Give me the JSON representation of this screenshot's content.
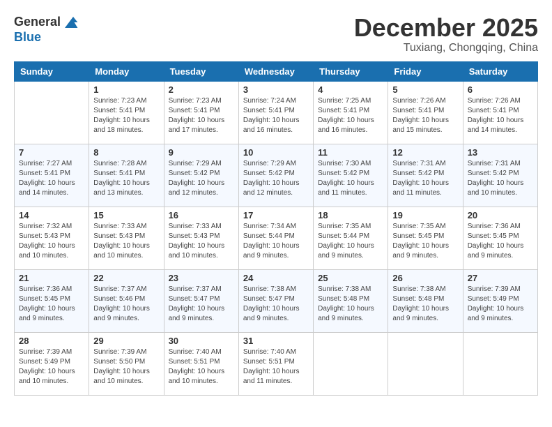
{
  "header": {
    "logo_general": "General",
    "logo_blue": "Blue",
    "month_title": "December 2025",
    "location": "Tuxiang, Chongqing, China"
  },
  "weekdays": [
    "Sunday",
    "Monday",
    "Tuesday",
    "Wednesday",
    "Thursday",
    "Friday",
    "Saturday"
  ],
  "weeks": [
    [
      {
        "day": "",
        "info": ""
      },
      {
        "day": "1",
        "info": "Sunrise: 7:23 AM\nSunset: 5:41 PM\nDaylight: 10 hours\nand 18 minutes."
      },
      {
        "day": "2",
        "info": "Sunrise: 7:23 AM\nSunset: 5:41 PM\nDaylight: 10 hours\nand 17 minutes."
      },
      {
        "day": "3",
        "info": "Sunrise: 7:24 AM\nSunset: 5:41 PM\nDaylight: 10 hours\nand 16 minutes."
      },
      {
        "day": "4",
        "info": "Sunrise: 7:25 AM\nSunset: 5:41 PM\nDaylight: 10 hours\nand 16 minutes."
      },
      {
        "day": "5",
        "info": "Sunrise: 7:26 AM\nSunset: 5:41 PM\nDaylight: 10 hours\nand 15 minutes."
      },
      {
        "day": "6",
        "info": "Sunrise: 7:26 AM\nSunset: 5:41 PM\nDaylight: 10 hours\nand 14 minutes."
      }
    ],
    [
      {
        "day": "7",
        "info": "Sunrise: 7:27 AM\nSunset: 5:41 PM\nDaylight: 10 hours\nand 14 minutes."
      },
      {
        "day": "8",
        "info": "Sunrise: 7:28 AM\nSunset: 5:41 PM\nDaylight: 10 hours\nand 13 minutes."
      },
      {
        "day": "9",
        "info": "Sunrise: 7:29 AM\nSunset: 5:42 PM\nDaylight: 10 hours\nand 12 minutes."
      },
      {
        "day": "10",
        "info": "Sunrise: 7:29 AM\nSunset: 5:42 PM\nDaylight: 10 hours\nand 12 minutes."
      },
      {
        "day": "11",
        "info": "Sunrise: 7:30 AM\nSunset: 5:42 PM\nDaylight: 10 hours\nand 11 minutes."
      },
      {
        "day": "12",
        "info": "Sunrise: 7:31 AM\nSunset: 5:42 PM\nDaylight: 10 hours\nand 11 minutes."
      },
      {
        "day": "13",
        "info": "Sunrise: 7:31 AM\nSunset: 5:42 PM\nDaylight: 10 hours\nand 10 minutes."
      }
    ],
    [
      {
        "day": "14",
        "info": "Sunrise: 7:32 AM\nSunset: 5:43 PM\nDaylight: 10 hours\nand 10 minutes."
      },
      {
        "day": "15",
        "info": "Sunrise: 7:33 AM\nSunset: 5:43 PM\nDaylight: 10 hours\nand 10 minutes."
      },
      {
        "day": "16",
        "info": "Sunrise: 7:33 AM\nSunset: 5:43 PM\nDaylight: 10 hours\nand 10 minutes."
      },
      {
        "day": "17",
        "info": "Sunrise: 7:34 AM\nSunset: 5:44 PM\nDaylight: 10 hours\nand 9 minutes."
      },
      {
        "day": "18",
        "info": "Sunrise: 7:35 AM\nSunset: 5:44 PM\nDaylight: 10 hours\nand 9 minutes."
      },
      {
        "day": "19",
        "info": "Sunrise: 7:35 AM\nSunset: 5:45 PM\nDaylight: 10 hours\nand 9 minutes."
      },
      {
        "day": "20",
        "info": "Sunrise: 7:36 AM\nSunset: 5:45 PM\nDaylight: 10 hours\nand 9 minutes."
      }
    ],
    [
      {
        "day": "21",
        "info": "Sunrise: 7:36 AM\nSunset: 5:45 PM\nDaylight: 10 hours\nand 9 minutes."
      },
      {
        "day": "22",
        "info": "Sunrise: 7:37 AM\nSunset: 5:46 PM\nDaylight: 10 hours\nand 9 minutes."
      },
      {
        "day": "23",
        "info": "Sunrise: 7:37 AM\nSunset: 5:47 PM\nDaylight: 10 hours\nand 9 minutes."
      },
      {
        "day": "24",
        "info": "Sunrise: 7:38 AM\nSunset: 5:47 PM\nDaylight: 10 hours\nand 9 minutes."
      },
      {
        "day": "25",
        "info": "Sunrise: 7:38 AM\nSunset: 5:48 PM\nDaylight: 10 hours\nand 9 minutes."
      },
      {
        "day": "26",
        "info": "Sunrise: 7:38 AM\nSunset: 5:48 PM\nDaylight: 10 hours\nand 9 minutes."
      },
      {
        "day": "27",
        "info": "Sunrise: 7:39 AM\nSunset: 5:49 PM\nDaylight: 10 hours\nand 9 minutes."
      }
    ],
    [
      {
        "day": "28",
        "info": "Sunrise: 7:39 AM\nSunset: 5:49 PM\nDaylight: 10 hours\nand 10 minutes."
      },
      {
        "day": "29",
        "info": "Sunrise: 7:39 AM\nSunset: 5:50 PM\nDaylight: 10 hours\nand 10 minutes."
      },
      {
        "day": "30",
        "info": "Sunrise: 7:40 AM\nSunset: 5:51 PM\nDaylight: 10 hours\nand 10 minutes."
      },
      {
        "day": "31",
        "info": "Sunrise: 7:40 AM\nSunset: 5:51 PM\nDaylight: 10 hours\nand 11 minutes."
      },
      {
        "day": "",
        "info": ""
      },
      {
        "day": "",
        "info": ""
      },
      {
        "day": "",
        "info": ""
      }
    ]
  ]
}
